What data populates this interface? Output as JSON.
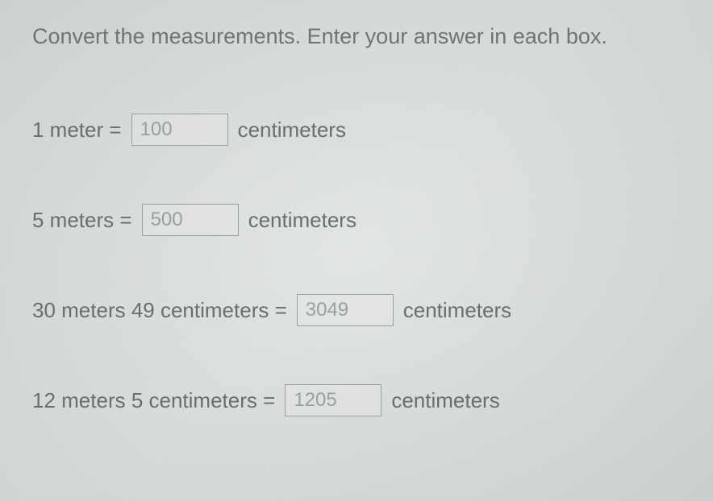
{
  "instruction": "Convert the measurements.  Enter your answer in each box.",
  "rows": [
    {
      "left": "1 meter =",
      "value": "100",
      "right": "centimeters"
    },
    {
      "left": "5 meters =",
      "value": "500",
      "right": "centimeters"
    },
    {
      "left": "30 meters 49 centimeters =",
      "value": "3049",
      "right": "centimeters"
    },
    {
      "left": "12 meters 5 centimeters =",
      "value": "1205",
      "right": "centimeters"
    }
  ]
}
